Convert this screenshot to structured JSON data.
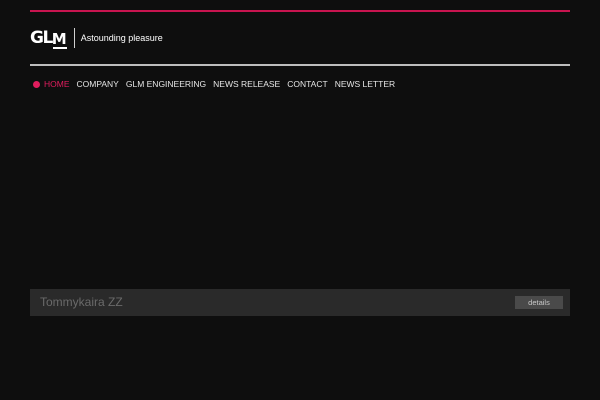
{
  "brand": {
    "logo_text_gl": "GL",
    "logo_text_m": "M",
    "tagline": "Astounding pleasure"
  },
  "nav": {
    "items": [
      {
        "label": "HOME",
        "active": true
      },
      {
        "label": "COMPANY",
        "active": false
      },
      {
        "label": "GLM ENGINEERING",
        "active": false
      },
      {
        "label": "NEWS RELEASE",
        "active": false
      },
      {
        "label": "CONTACT",
        "active": false
      },
      {
        "label": "NEWS LETTER",
        "active": false
      }
    ]
  },
  "caption": {
    "title": "Tommykaira ZZ",
    "details_label": "details"
  },
  "colors": {
    "accent": "#e11d5e",
    "background": "#0e0e0e",
    "caption_bar": "#2a2a2a"
  }
}
